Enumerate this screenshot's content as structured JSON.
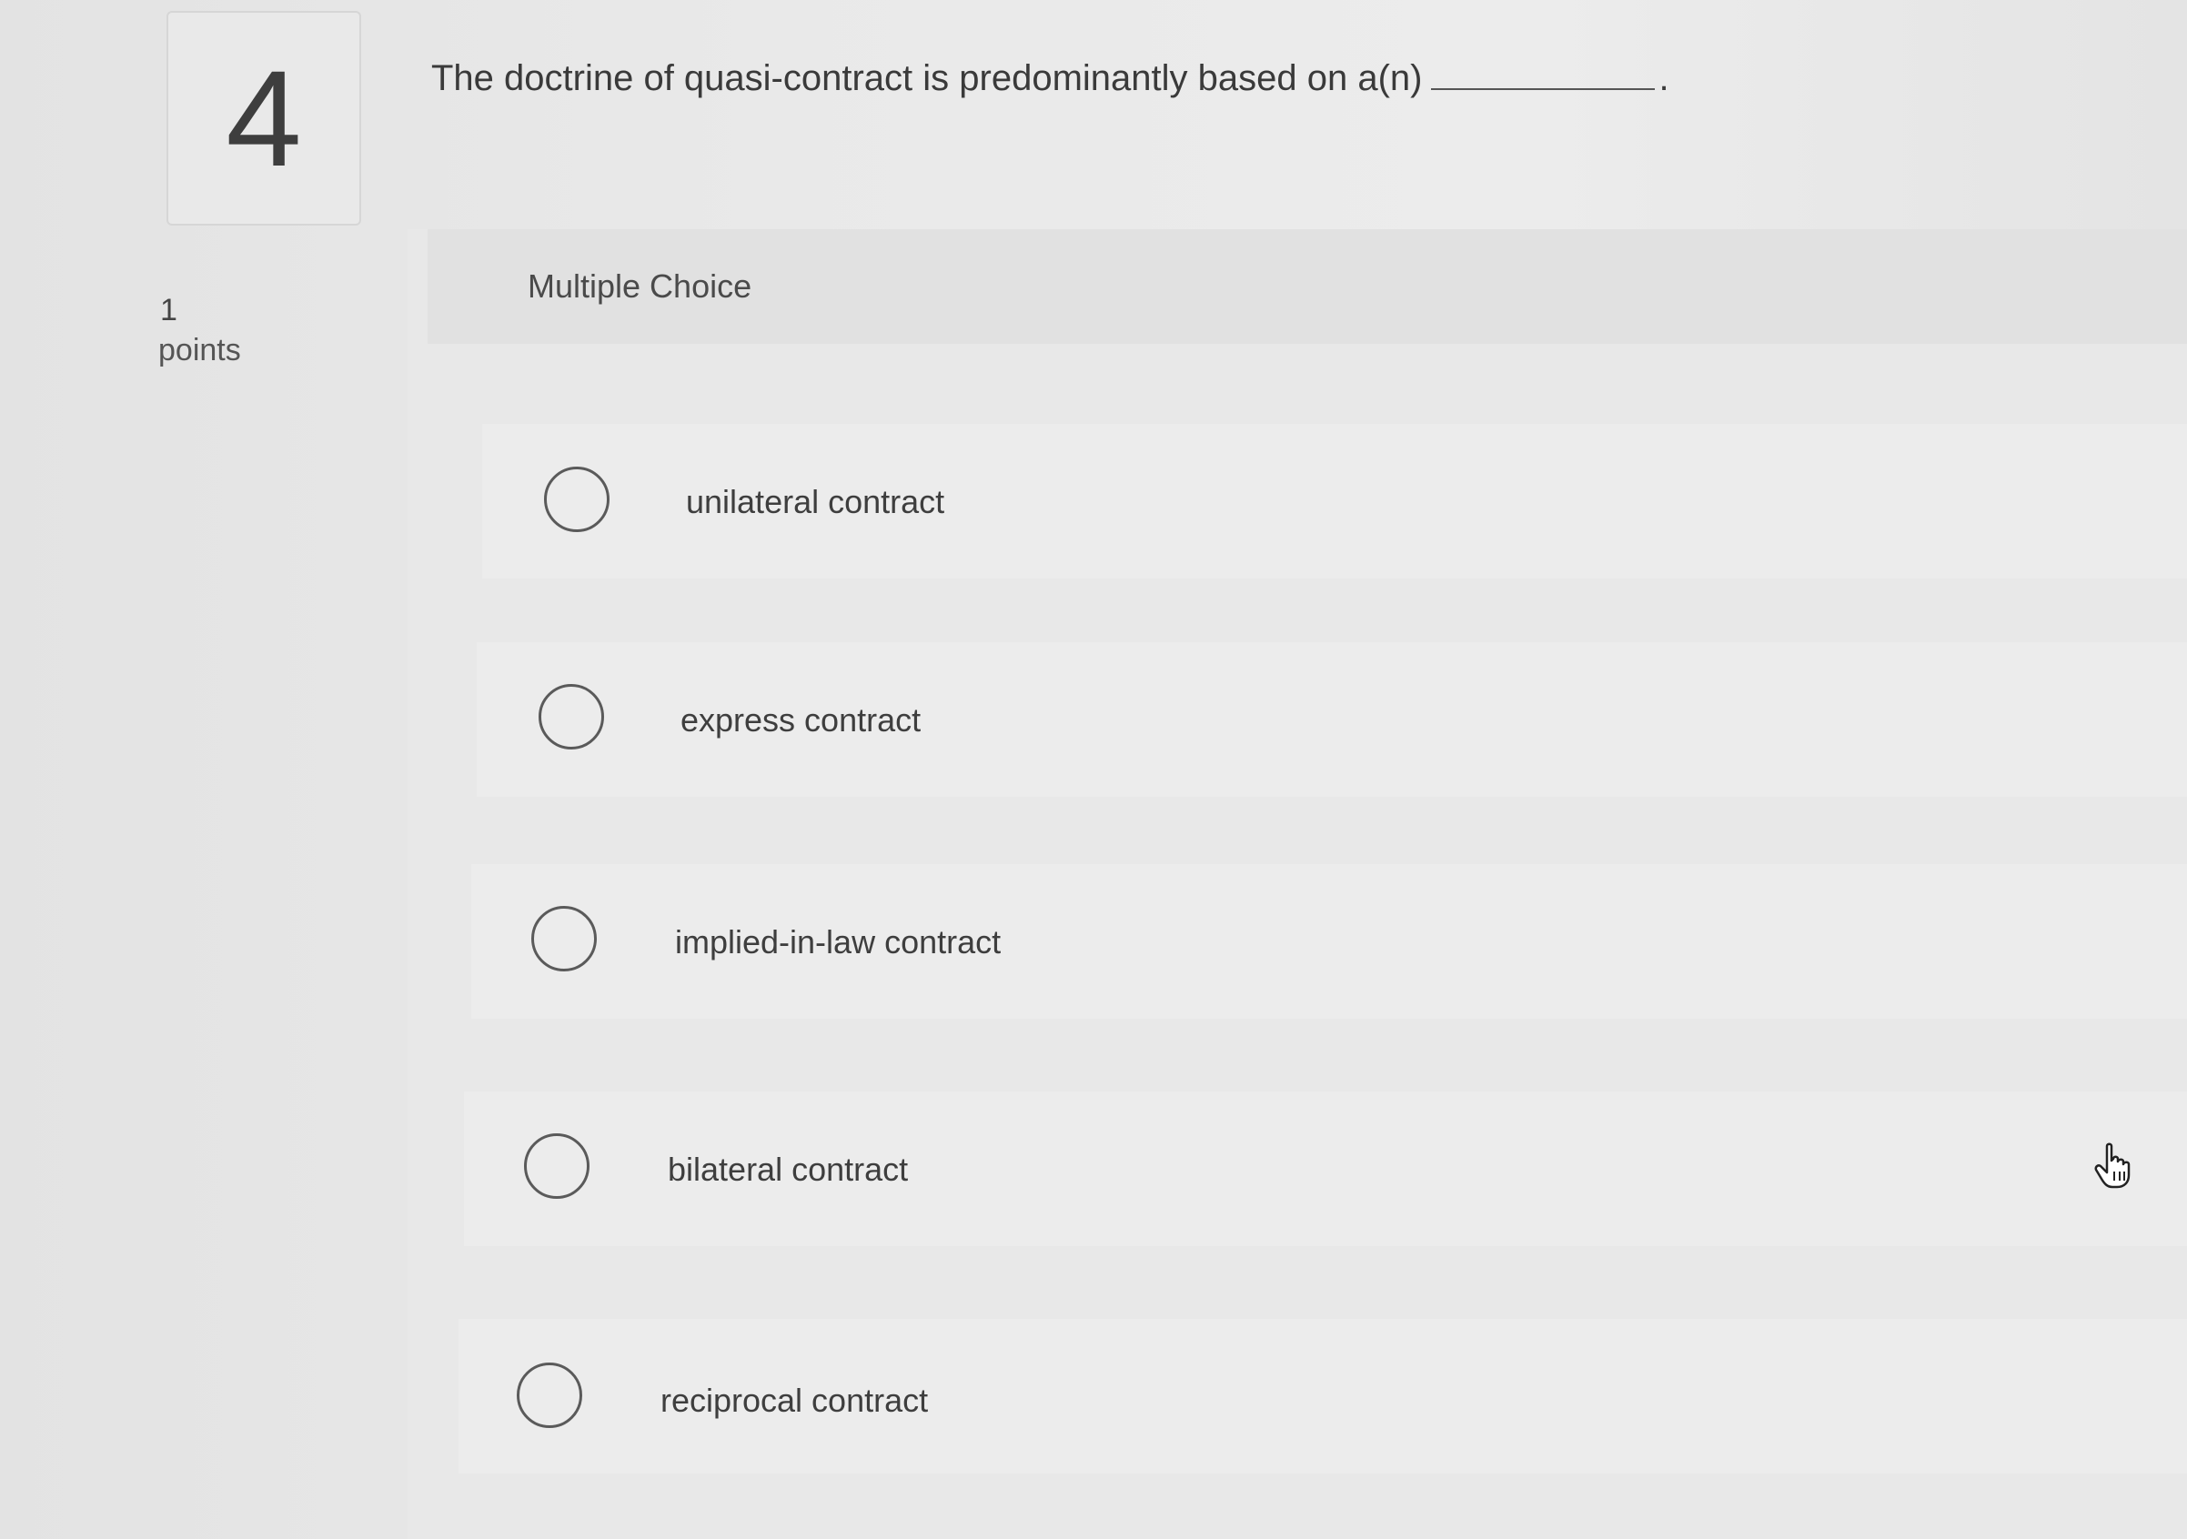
{
  "question": {
    "number": "4",
    "text": "The doctrine of quasi-contract is predominantly based on a(n)",
    "blank_suffix": ".",
    "points_value": "1",
    "points_label": "points"
  },
  "answer_section": {
    "type_label": "Multiple Choice",
    "options": [
      {
        "label": "unilateral contract",
        "selected": false
      },
      {
        "label": "express contract",
        "selected": false
      },
      {
        "label": "implied-in-law contract",
        "selected": false
      },
      {
        "label": "bilateral contract",
        "selected": false
      },
      {
        "label": "reciprocal contract",
        "selected": false
      }
    ]
  },
  "icons": {
    "radio": "radio-unselected-icon",
    "cursor": "pointer-hand-icon"
  },
  "colors": {
    "background": "#e6e6e6",
    "text": "#3c3c3c",
    "radio_border": "#5a5a5a"
  }
}
